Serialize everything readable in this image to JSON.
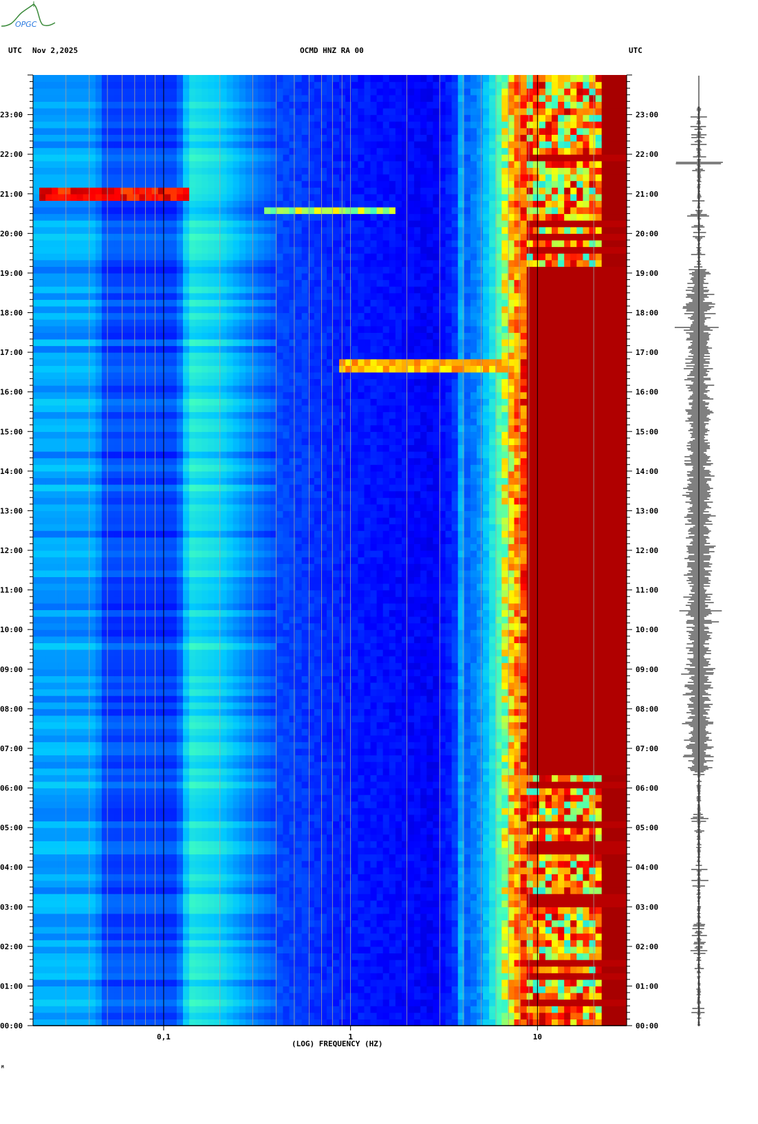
{
  "logo": {
    "text": "OPGC"
  },
  "header": {
    "left_tz": "UTC",
    "date": "Nov 2,2025",
    "station": "OCMD HNZ RA 00",
    "right_tz": "UTC"
  },
  "footer_mark": "M",
  "chart_data": {
    "type": "heatmap",
    "title": "OCMD HNZ RA 00",
    "xlabel": "(LOG) FREQUENCY (HZ)",
    "ylabel": "UTC",
    "xscale": "log",
    "xlim": [
      0.02,
      30
    ],
    "ylim_hours": [
      0,
      24
    ],
    "x_ticks": [
      {
        "value": 0.1,
        "label": "0,1"
      },
      {
        "value": 1,
        "label": "1"
      },
      {
        "value": 10,
        "label": "10"
      }
    ],
    "y_ticks": [
      "00:00",
      "01:00",
      "02:00",
      "03:00",
      "04:00",
      "05:00",
      "06:00",
      "07:00",
      "08:00",
      "09:00",
      "10:00",
      "11:00",
      "12:00",
      "13:00",
      "14:00",
      "15:00",
      "16:00",
      "17:00",
      "18:00",
      "19:00",
      "20:00",
      "21:00",
      "22:00",
      "23:00"
    ],
    "colormap": [
      "#00008c",
      "#0000ff",
      "#0060ff",
      "#00c8ff",
      "#40ffc0",
      "#ffff00",
      "#ff8000",
      "#ff0000",
      "#8b0000"
    ],
    "grid_color": "#a0a0a0",
    "background_profile_log10f": [
      [
        -1.7,
        0.33
      ],
      [
        -1.36,
        0.33
      ],
      [
        -1.32,
        0.22
      ],
      [
        -0.93,
        0.21
      ],
      [
        -0.86,
        0.44
      ],
      [
        -0.7,
        0.4
      ],
      [
        -0.55,
        0.3
      ],
      [
        -0.4,
        0.22
      ],
      [
        0,
        0.16
      ],
      [
        0.45,
        0.12
      ],
      [
        0.52,
        0.16
      ],
      [
        0.7,
        0.32
      ],
      [
        0.8,
        0.52
      ],
      [
        0.88,
        0.72
      ],
      [
        0.95,
        0.86
      ],
      [
        1.05,
        0.95
      ],
      [
        1.48,
        0.97
      ]
    ],
    "quiet_periods_hours": [
      [
        0,
        6.4
      ],
      [
        19.1,
        24
      ]
    ],
    "events": [
      {
        "time": "21:00",
        "fmin": 0.022,
        "fmax": 0.14,
        "level": 0.8
      },
      {
        "time": "20:37",
        "fmin": 0.35,
        "fmax": 1.7,
        "level": 0.5
      },
      {
        "time": "16:40",
        "fmin": 0.9,
        "fmax": 7,
        "level": 0.62
      }
    ]
  }
}
